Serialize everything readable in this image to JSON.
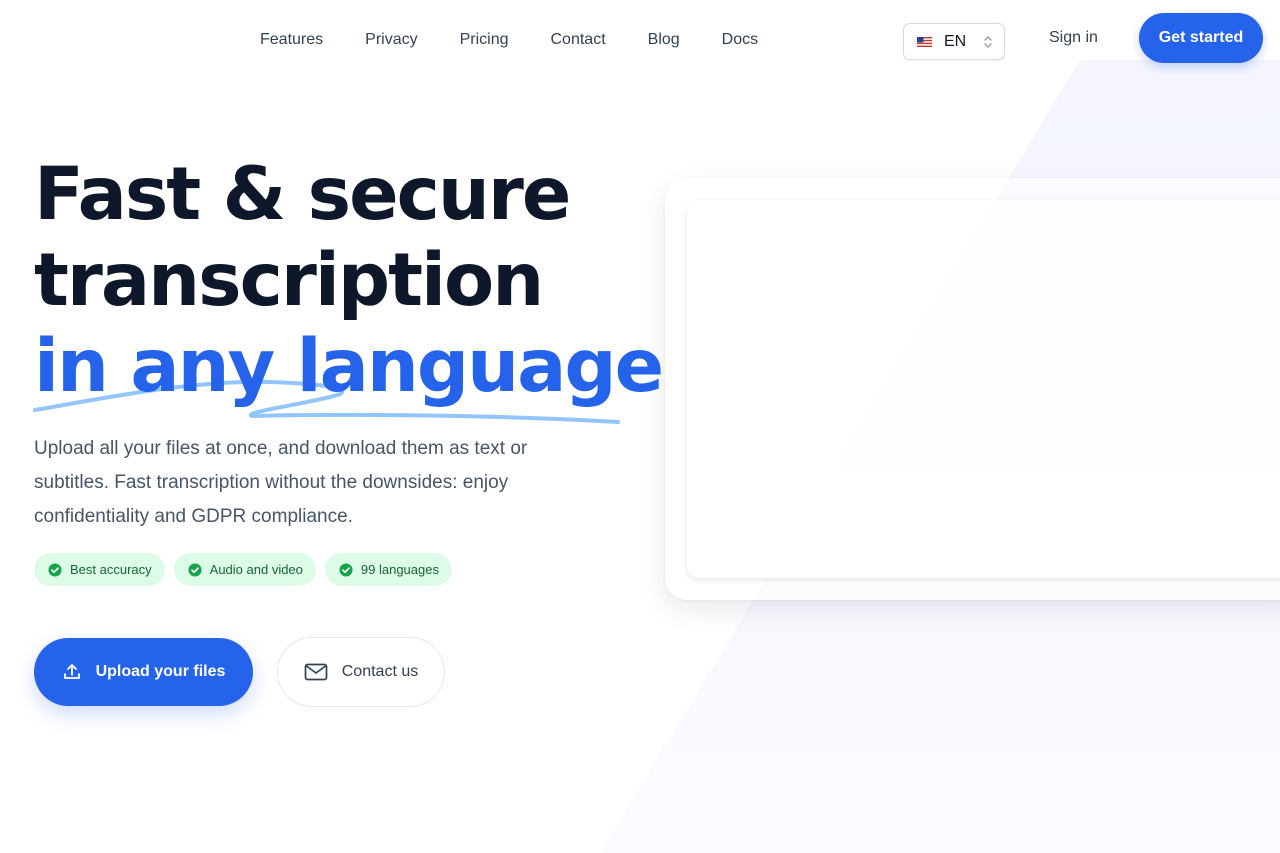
{
  "nav": {
    "links": [
      "Features",
      "Privacy",
      "Pricing",
      "Contact",
      "Blog",
      "Docs"
    ],
    "language": {
      "code": "EN",
      "flag_icon": "us-flag-icon"
    },
    "sign_in": "Sign in",
    "get_started": "Get started"
  },
  "hero": {
    "title_line1": "Fast & secure",
    "title_line2": "transcription",
    "title_accent": "in any language",
    "description": "Upload all your files at once, and download them as text or subtitles. Fast transcription without the downsides: enjoy confidentiality and GDPR compliance.",
    "features": [
      "Best accuracy",
      "Audio and video",
      "99 languages"
    ],
    "upload_button": "Upload your files",
    "contact_button": "Contact us"
  },
  "colors": {
    "accent": "#2563eb",
    "heading": "#0f172a",
    "body_text": "#475569",
    "chip_bg": "#dcfce7",
    "chip_text": "#166534",
    "check": "#16a34a",
    "swoosh": "#93c5fd",
    "panel": "#f5f6fe"
  }
}
